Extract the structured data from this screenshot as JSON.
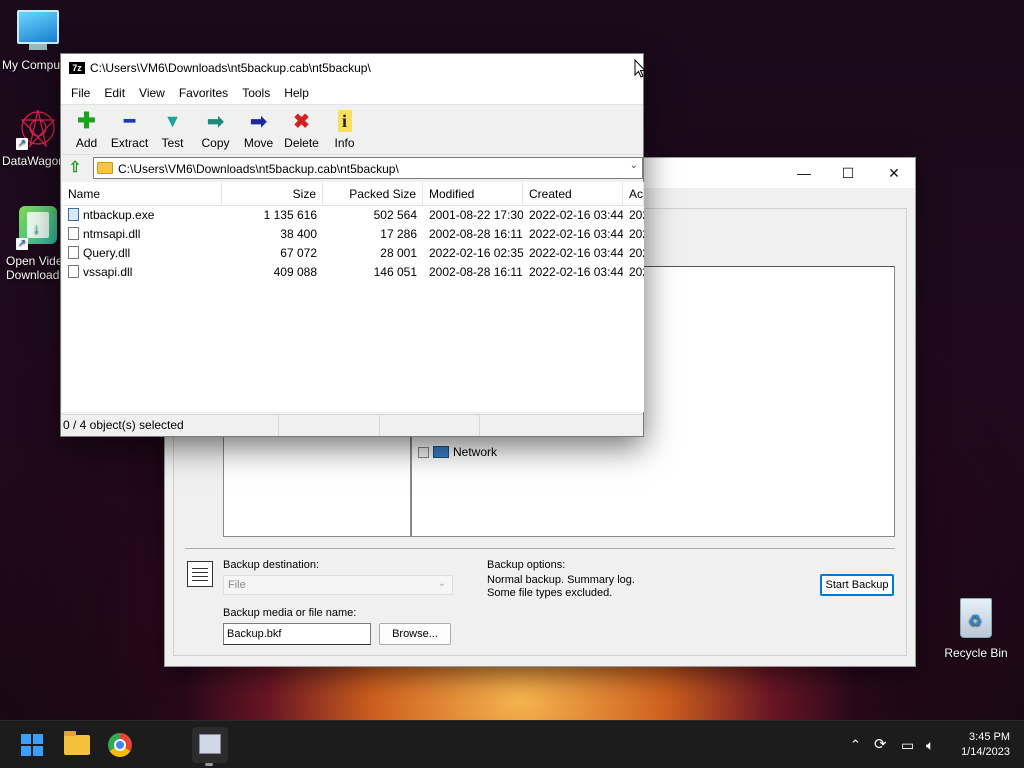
{
  "desktop": {
    "icons": [
      {
        "label": "My Compu",
        "icon": "computer-icon"
      },
      {
        "label": "DataWagon",
        "icon": "datawagon-icon"
      },
      {
        "label": "Open Video Download",
        "label_line1": "Open Vide",
        "label_line2": "Download",
        "icon": "video-download-icon"
      },
      {
        "label": "Recycle Bin",
        "icon": "recycle-bin-icon"
      }
    ]
  },
  "backup_window": {
    "tree_items": [
      {
        "label": "Network"
      }
    ],
    "destination_label": "Backup destination:",
    "destination_value": "File",
    "options_label": "Backup options:",
    "options_line1": "Normal backup.  Summary log.",
    "options_line2": "Some file types excluded.",
    "media_label": "Backup media or file name:",
    "media_value": "Backup.bkf",
    "browse_label": "Browse...",
    "start_label": "Start Backup",
    "controls": {
      "minimize": "—",
      "maximize": "☐",
      "close": "✕"
    }
  },
  "zip_window": {
    "title": "C:\\Users\\VM6\\Downloads\\nt5backup.cab\\nt5backup\\",
    "logo_text": "7z",
    "menu": [
      "File",
      "Edit",
      "View",
      "Favorites",
      "Tools",
      "Help"
    ],
    "toolbar": [
      {
        "label": "Add",
        "icon": "add-icon",
        "glyph": "✚",
        "color": "#1aa31a"
      },
      {
        "label": "Extract",
        "icon": "extract-icon",
        "glyph": "━",
        "color": "#1a3cb4"
      },
      {
        "label": "Test",
        "icon": "test-icon",
        "glyph": "▼",
        "color": "#1aa39a"
      },
      {
        "label": "Copy",
        "icon": "copy-icon",
        "glyph": "➡",
        "color": "#1a8a7a"
      },
      {
        "label": "Move",
        "icon": "move-icon",
        "glyph": "➡",
        "color": "#1a2a9a"
      },
      {
        "label": "Delete",
        "icon": "delete-icon",
        "glyph": "✖",
        "color": "#d42020"
      },
      {
        "label": "Info",
        "icon": "info-icon",
        "glyph": "i",
        "color": "#222"
      }
    ],
    "address": "C:\\Users\\VM6\\Downloads\\nt5backup.cab\\nt5backup\\",
    "columns": [
      "Name",
      "Size",
      "Packed Size",
      "Modified",
      "Created",
      "Ac"
    ],
    "files": [
      {
        "name": "ntbackup.exe",
        "size": "1 135 616",
        "packed": "502 564",
        "modified": "2001-08-22 17:30",
        "created": "2022-02-16 03:44",
        "accessed": "202",
        "type": "exe"
      },
      {
        "name": "ntmsapi.dll",
        "size": "38 400",
        "packed": "17 286",
        "modified": "2002-08-28 16:11",
        "created": "2022-02-16 03:44",
        "accessed": "202",
        "type": "dll"
      },
      {
        "name": "Query.dll",
        "size": "67 072",
        "packed": "28 001",
        "modified": "2022-02-16 02:35",
        "created": "2022-02-16 03:44",
        "accessed": "202",
        "type": "dll"
      },
      {
        "name": "vssapi.dll",
        "size": "409 088",
        "packed": "146 051",
        "modified": "2002-08-28 16:11",
        "created": "2022-02-16 03:44",
        "accessed": "202",
        "type": "dll"
      }
    ],
    "status": "0 / 4 object(s) selected"
  },
  "taskbar": {
    "time": "3:45 PM",
    "date": "1/14/2023",
    "tray_icons": [
      "chevron-up-icon",
      "sync-icon",
      "network-icon",
      "volume-icon"
    ]
  },
  "colors": {
    "accent": "#0078d4",
    "taskbar_bg": "#1c1c1c"
  }
}
